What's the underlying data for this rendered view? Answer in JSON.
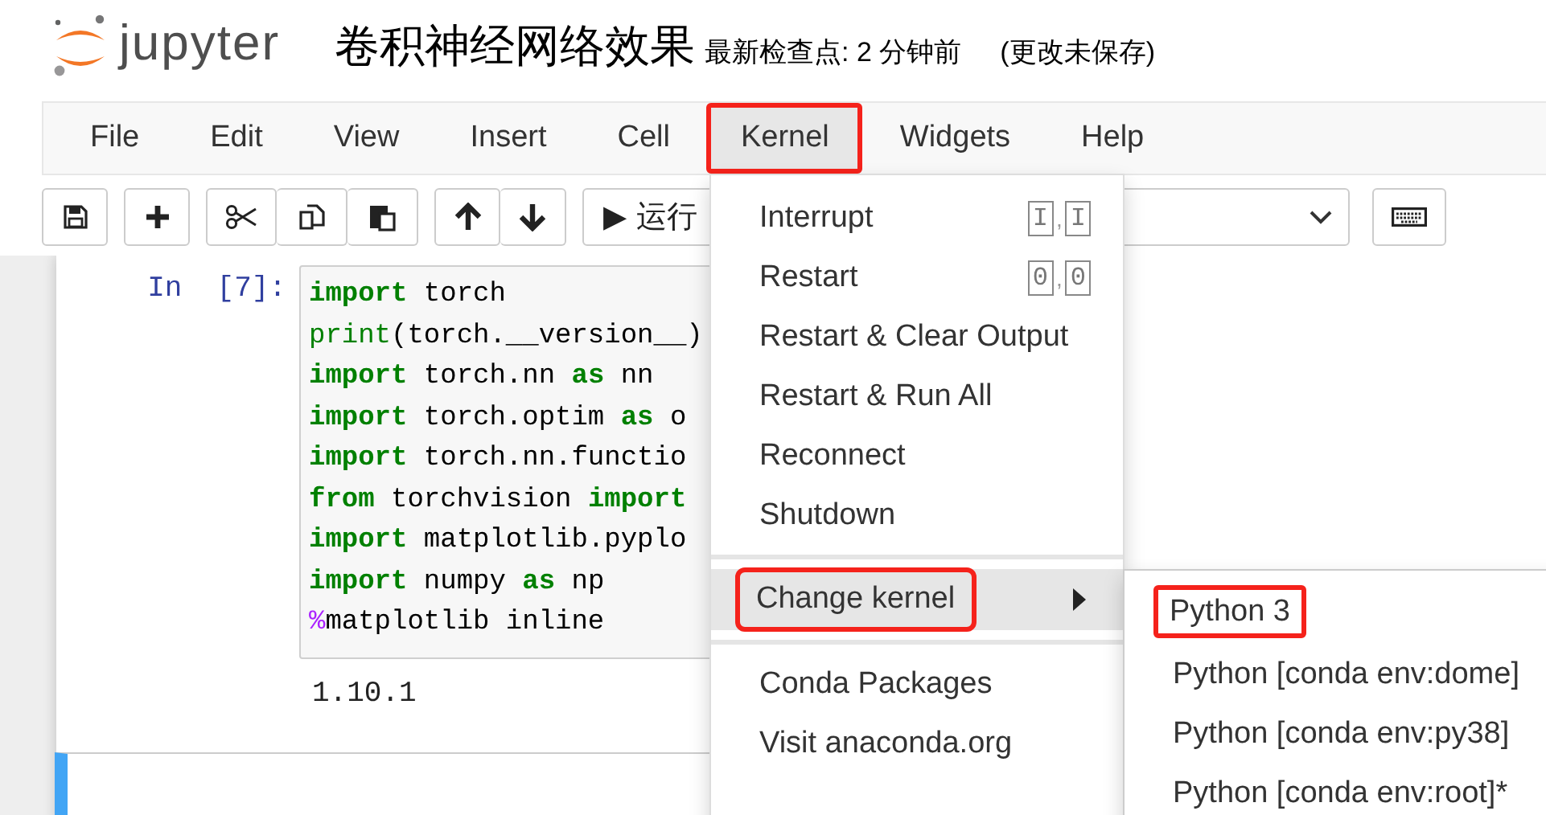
{
  "header": {
    "logo_text": "jupyter",
    "title": "卷积神经网络效果",
    "checkpoint": "最新检查点: 2 分钟前",
    "save_status": "(更改未保存)"
  },
  "menubar": [
    {
      "label": "File",
      "highlighted": false,
      "open": false
    },
    {
      "label": "Edit",
      "highlighted": false,
      "open": false
    },
    {
      "label": "View",
      "highlighted": false,
      "open": false
    },
    {
      "label": "Insert",
      "highlighted": false,
      "open": false
    },
    {
      "label": "Cell",
      "highlighted": false,
      "open": false
    },
    {
      "label": "Kernel",
      "highlighted": true,
      "open": true
    },
    {
      "label": "Widgets",
      "highlighted": false,
      "open": false
    },
    {
      "label": "Help",
      "highlighted": false,
      "open": false
    }
  ],
  "toolbar": [
    [
      {
        "kind": "save"
      }
    ],
    [
      {
        "kind": "add"
      }
    ],
    [
      {
        "kind": "cut"
      },
      {
        "kind": "copy"
      },
      {
        "kind": "paste"
      }
    ],
    [
      {
        "kind": "up"
      },
      {
        "kind": "down"
      }
    ],
    [
      {
        "kind": "run",
        "glyph": "▶",
        "label": "运行"
      }
    ],
    [
      {
        "kind": "select"
      }
    ],
    [
      {
        "kind": "keyboard"
      }
    ]
  ],
  "cell": {
    "prompt": "In",
    "count": "[7]:",
    "lines": [
      {
        "tokens": [
          {
            "kind": "keyword",
            "text": "import"
          },
          {
            "kind": "plain",
            "text": " torch"
          }
        ]
      },
      {
        "tokens": [
          {
            "kind": "builtin",
            "text": "print"
          },
          {
            "kind": "plain",
            "text": "(torch.__version__)"
          }
        ]
      },
      {
        "tokens": [
          {
            "kind": "keyword",
            "text": "import"
          },
          {
            "kind": "plain",
            "text": " torch.nn "
          },
          {
            "kind": "keyword",
            "text": "as"
          },
          {
            "kind": "plain",
            "text": " nn"
          }
        ]
      },
      {
        "tokens": [
          {
            "kind": "keyword",
            "text": "import"
          },
          {
            "kind": "plain",
            "text": " torch.optim "
          },
          {
            "kind": "keyword",
            "text": "as"
          },
          {
            "kind": "plain",
            "text": " o"
          }
        ]
      },
      {
        "tokens": [
          {
            "kind": "keyword",
            "text": "import"
          },
          {
            "kind": "plain",
            "text": " torch.nn.functio"
          }
        ]
      },
      {
        "tokens": [
          {
            "kind": "keyword",
            "text": "from"
          },
          {
            "kind": "plain",
            "text": " torchvision "
          },
          {
            "kind": "keyword",
            "text": "import"
          }
        ]
      },
      {
        "tokens": [
          {
            "kind": "keyword",
            "text": "import"
          },
          {
            "kind": "plain",
            "text": " matplotlib.pyplo"
          }
        ]
      },
      {
        "tokens": [
          {
            "kind": "keyword",
            "text": "import"
          },
          {
            "kind": "plain",
            "text": " numpy "
          },
          {
            "kind": "keyword",
            "text": "as"
          },
          {
            "kind": "plain",
            "text": " np"
          }
        ]
      },
      {
        "tokens": [
          {
            "kind": "magic",
            "text": "%"
          },
          {
            "kind": "plain",
            "text": "matplotlib inline"
          }
        ]
      }
    ],
    "output": "1.10.1"
  },
  "markdown_cell": {
    "selected": true
  },
  "kernel_menu": {
    "items": [
      {
        "kind": "item",
        "label": "Interrupt",
        "shortcut": {
          "keys": [
            "I",
            "I"
          ],
          "separator": ","
        },
        "active": false,
        "highlighted": false
      },
      {
        "kind": "item",
        "label": "Restart",
        "shortcut": {
          "keys": [
            "0",
            "0"
          ],
          "separator": ","
        },
        "active": false,
        "highlighted": false
      },
      {
        "kind": "item",
        "label": "Restart & Clear Output",
        "active": false,
        "highlighted": false
      },
      {
        "kind": "item",
        "label": "Restart & Run All",
        "active": false,
        "highlighted": false
      },
      {
        "kind": "item",
        "label": "Reconnect",
        "active": false,
        "highlighted": false
      },
      {
        "kind": "item",
        "label": "Shutdown",
        "active": false,
        "highlighted": false
      },
      {
        "kind": "divider"
      },
      {
        "kind": "submenu",
        "label": "Change kernel",
        "active": true,
        "highlighted": true
      },
      {
        "kind": "divider"
      },
      {
        "kind": "item",
        "label": "Conda Packages",
        "active": false,
        "highlighted": false
      },
      {
        "kind": "item",
        "label": "Visit anaconda.org",
        "active": false,
        "highlighted": false
      }
    ]
  },
  "kernel_submenu": {
    "items": [
      {
        "label": "Python 3",
        "highlighted": true
      },
      {
        "label": "Python [conda env:dome]",
        "highlighted": false
      },
      {
        "label": "Python [conda env:py38]",
        "highlighted": false
      },
      {
        "label": "Python [conda env:root]*",
        "highlighted": false
      }
    ]
  }
}
